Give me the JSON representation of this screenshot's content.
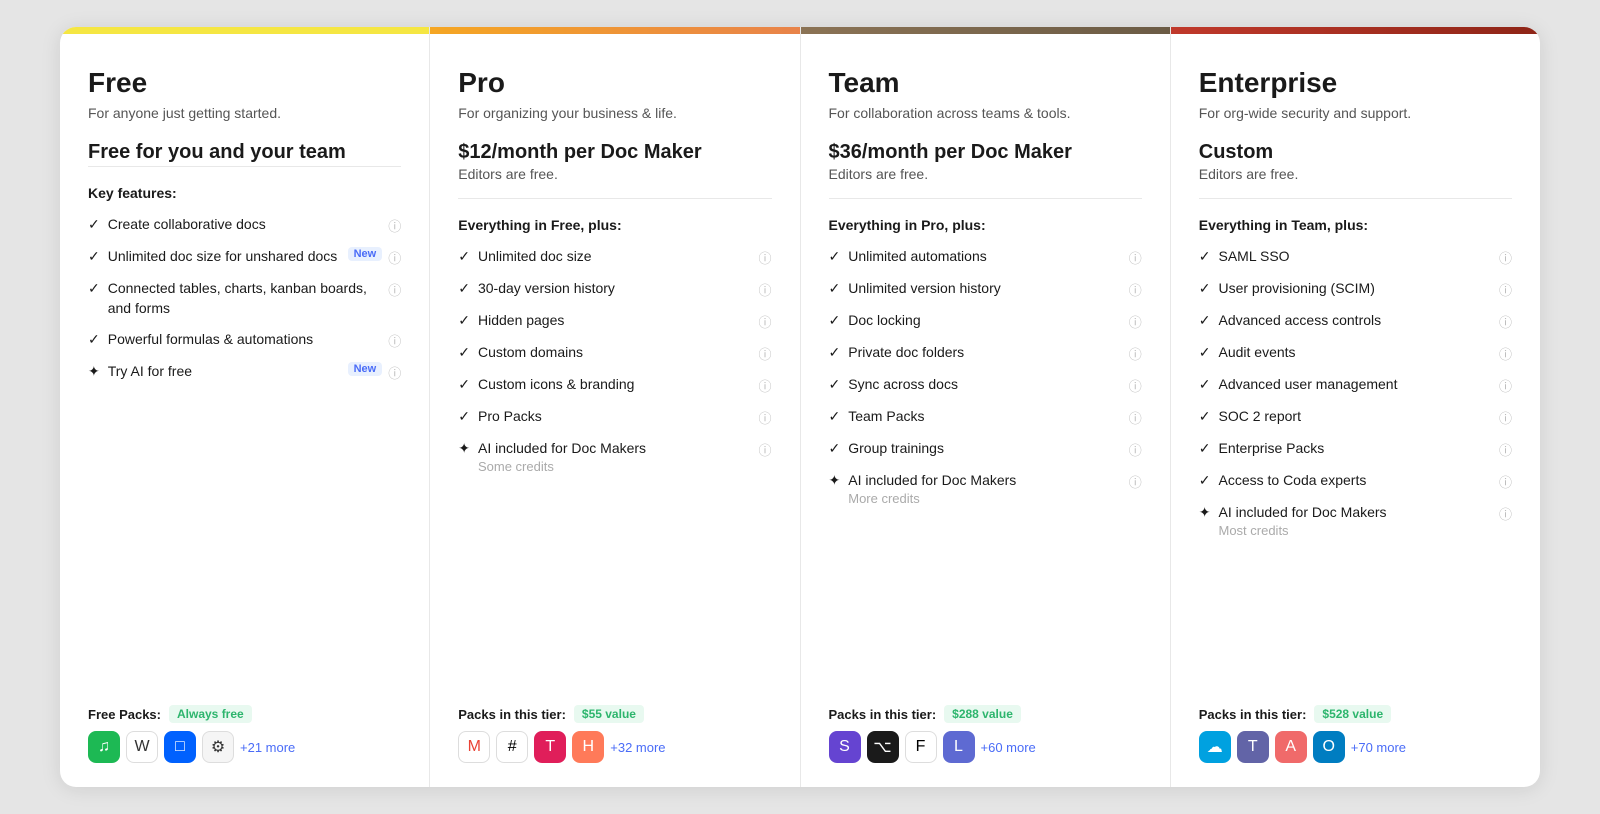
{
  "plans": [
    {
      "id": "free",
      "name": "Free",
      "tagline": "For anyone just getting started.",
      "price": "Free for you and your team",
      "priceSub": "",
      "barClass": "bar-free",
      "featuresHeader": "Key features:",
      "features": [
        {
          "type": "check",
          "text": "Create collaborative docs",
          "badge": null,
          "sub": null
        },
        {
          "type": "check",
          "text": "Unlimited doc size for unshared docs",
          "badge": "New",
          "sub": null
        },
        {
          "type": "check",
          "text": "Connected tables, charts, kanban boards, and forms",
          "badge": null,
          "sub": null
        },
        {
          "type": "check",
          "text": "Powerful formulas & automations",
          "badge": null,
          "sub": null
        },
        {
          "type": "ai",
          "text": "Try AI for free",
          "badge": "New",
          "sub": null
        }
      ],
      "packsLabel": "Free Packs:",
      "packsValue": "Always free",
      "packIcons": [
        "spotify",
        "wikipedia",
        "dropbox",
        "coda"
      ],
      "packsMore": "+21 more"
    },
    {
      "id": "pro",
      "name": "Pro",
      "tagline": "For organizing your business & life.",
      "price": "$12/month per Doc Maker",
      "priceSub": "Editors are free.",
      "barClass": "bar-pro",
      "featuresHeader": "Everything in Free, plus:",
      "features": [
        {
          "type": "check",
          "text": "Unlimited doc size",
          "badge": null,
          "sub": null
        },
        {
          "type": "check",
          "text": "30-day version history",
          "badge": null,
          "sub": null
        },
        {
          "type": "check",
          "text": "Hidden pages",
          "badge": null,
          "sub": null
        },
        {
          "type": "check",
          "text": "Custom domains",
          "badge": null,
          "sub": null
        },
        {
          "type": "check",
          "text": "Custom icons & branding",
          "badge": null,
          "sub": null
        },
        {
          "type": "check",
          "text": "Pro Packs",
          "badge": null,
          "sub": null
        },
        {
          "type": "ai",
          "text": "AI included for Doc Makers",
          "badge": null,
          "sub": "Some credits"
        }
      ],
      "packsLabel": "Packs in this tier:",
      "packsValue": "$55 value",
      "packIcons": [
        "gmail",
        "slack",
        "toggl",
        "hubspot"
      ],
      "packsMore": "+32 more"
    },
    {
      "id": "team",
      "name": "Team",
      "tagline": "For collaboration across teams & tools.",
      "price": "$36/month per Doc Maker",
      "priceSub": "Editors are free.",
      "barClass": "bar-team",
      "featuresHeader": "Everything in Pro, plus:",
      "features": [
        {
          "type": "check",
          "text": "Unlimited automations",
          "badge": null,
          "sub": null
        },
        {
          "type": "check",
          "text": "Unlimited version history",
          "badge": null,
          "sub": null
        },
        {
          "type": "check",
          "text": "Doc locking",
          "badge": null,
          "sub": null
        },
        {
          "type": "check",
          "text": "Private doc folders",
          "badge": null,
          "sub": null
        },
        {
          "type": "check",
          "text": "Sync across docs",
          "badge": null,
          "sub": null
        },
        {
          "type": "check",
          "text": "Team Packs",
          "badge": null,
          "sub": null
        },
        {
          "type": "check",
          "text": "Group trainings",
          "badge": null,
          "sub": null
        },
        {
          "type": "ai",
          "text": "AI included for Doc Makers",
          "badge": null,
          "sub": "More credits"
        }
      ],
      "packsLabel": "Packs in this tier:",
      "packsValue": "$288 value",
      "packIcons": [
        "shortcut",
        "github",
        "figma",
        "linear"
      ],
      "packsMore": "+60 more"
    },
    {
      "id": "enterprise",
      "name": "Enterprise",
      "tagline": "For org-wide security and support.",
      "price": "Custom",
      "priceSub": "Editors are free.",
      "barClass": "bar-enterprise",
      "featuresHeader": "Everything in Team, plus:",
      "features": [
        {
          "type": "check",
          "text": "SAML SSO",
          "badge": null,
          "sub": null
        },
        {
          "type": "check",
          "text": "User provisioning (SCIM)",
          "badge": null,
          "sub": null
        },
        {
          "type": "check",
          "text": "Advanced access controls",
          "badge": null,
          "sub": null
        },
        {
          "type": "check",
          "text": "Audit events",
          "badge": null,
          "sub": null
        },
        {
          "type": "check",
          "text": "Advanced user management",
          "badge": null,
          "sub": null
        },
        {
          "type": "check",
          "text": "SOC 2 report",
          "badge": null,
          "sub": null
        },
        {
          "type": "check",
          "text": "Enterprise Packs",
          "badge": null,
          "sub": null
        },
        {
          "type": "check",
          "text": "Access to Coda experts",
          "badge": null,
          "sub": null
        },
        {
          "type": "ai",
          "text": "AI included for Doc Makers",
          "badge": null,
          "sub": "Most credits"
        }
      ],
      "packsLabel": "Packs in this tier:",
      "packsValue": "$528 value",
      "packIcons": [
        "salesforce",
        "teams",
        "asana",
        "okta"
      ],
      "packsMore": "+70 more"
    }
  ],
  "packIconSymbols": {
    "spotify": "♫",
    "wikipedia": "W",
    "dropbox": "□",
    "coda": "⚙",
    "gmail": "M",
    "slack": "#",
    "toggl": "T",
    "hubspot": "H",
    "shortcut": "S",
    "github": "⌥",
    "figma": "F",
    "linear": "L",
    "salesforce": "☁",
    "teams": "T",
    "asana": "A",
    "okta": "O"
  }
}
